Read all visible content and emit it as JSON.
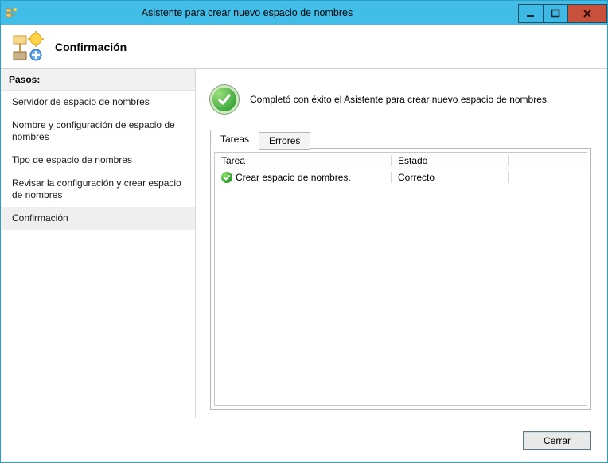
{
  "window": {
    "title": "Asistente para crear nuevo espacio de nombres"
  },
  "header": {
    "title": "Confirmación"
  },
  "sidebar": {
    "header": "Pasos:",
    "steps": [
      {
        "label": "Servidor de espacio de nombres"
      },
      {
        "label": "Nombre y configuración de espacio de nombres"
      },
      {
        "label": "Tipo de espacio de nombres"
      },
      {
        "label": "Revisar la configuración y crear espacio de nombres"
      },
      {
        "label": "Confirmación"
      }
    ],
    "active_index": 4
  },
  "main": {
    "status_message": "Completó con éxito el Asistente para crear nuevo espacio de nombres.",
    "tabs": [
      {
        "label": "Tareas"
      },
      {
        "label": "Errores"
      }
    ],
    "active_tab_index": 0,
    "columns": {
      "task": "Tarea",
      "status": "Estado"
    },
    "tasks": [
      {
        "task": "Crear espacio de nombres.",
        "status": "Correcto"
      }
    ]
  },
  "footer": {
    "close_label": "Cerrar"
  }
}
